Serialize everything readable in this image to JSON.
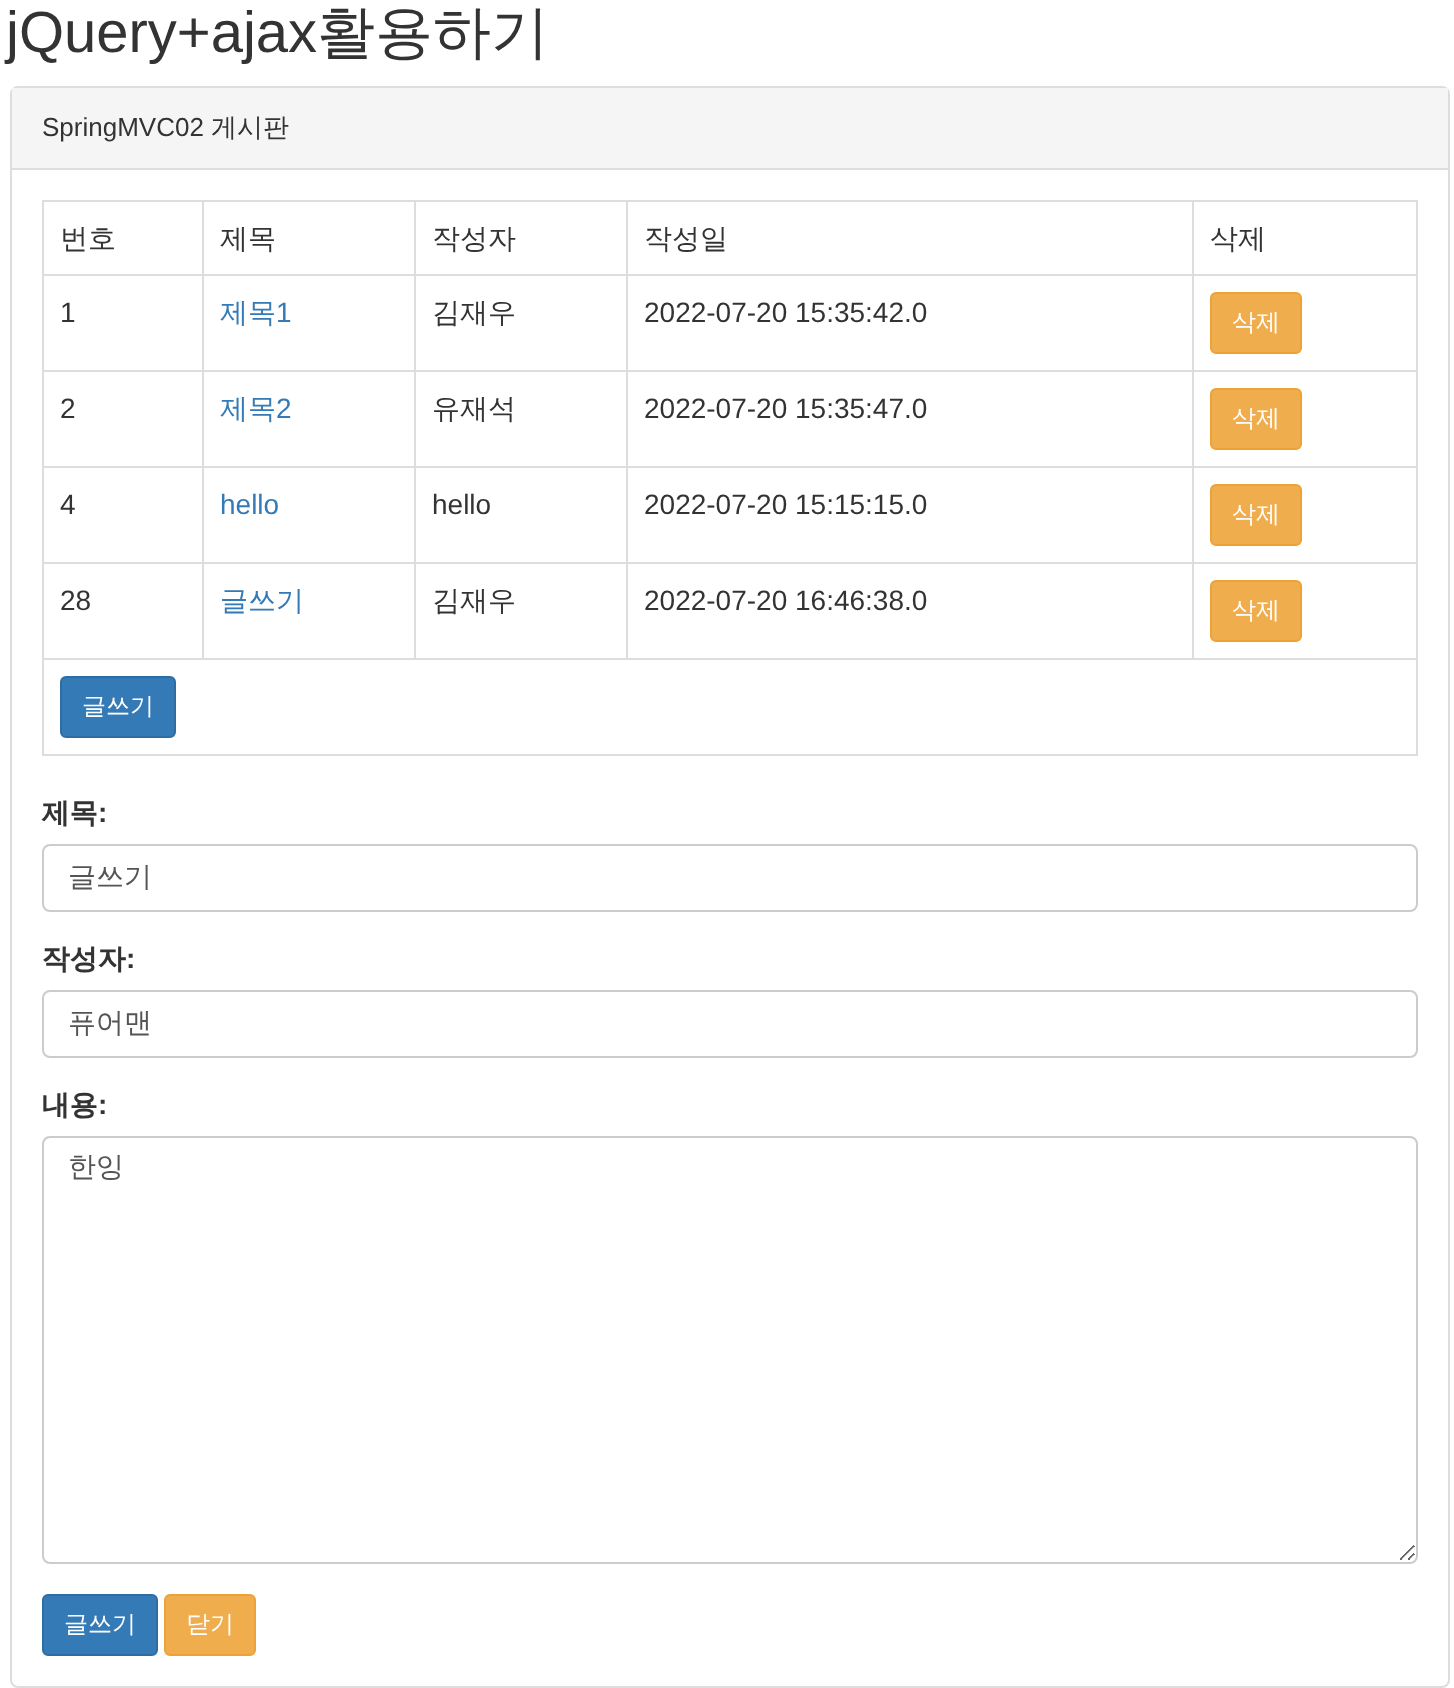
{
  "page_title": "jQuery+ajax활용하기",
  "panel": {
    "heading": "SpringMVC02 게시판",
    "table": {
      "columns": [
        "번호",
        "제목",
        "작성자",
        "작성일",
        "삭제"
      ],
      "rows": [
        {
          "number": "1",
          "title": "제목1",
          "writer": "김재우",
          "date": "2022-07-20 15:35:42.0",
          "delete_button": "삭제"
        },
        {
          "number": "2",
          "title": "제목2",
          "writer": "유재석",
          "date": "2022-07-20 15:35:47.0",
          "delete_button": "삭제"
        },
        {
          "number": "4",
          "title": "hello",
          "writer": "hello",
          "date": "2022-07-20 15:15:15.0",
          "delete_button": "삭제"
        },
        {
          "number": "28",
          "title": "글쓰기",
          "writer": "김재우",
          "date": "2022-07-20 16:46:38.0",
          "delete_button": "삭제"
        }
      ],
      "write_button": "글쓰기"
    },
    "form": {
      "fields": [
        {
          "kind": "input",
          "label": "제목:",
          "value": "글쓰기"
        },
        {
          "kind": "input",
          "label": "작성자:",
          "value": "퓨어맨"
        },
        {
          "kind": "textarea",
          "label": "내용:",
          "value": "한잉"
        }
      ],
      "buttons": [
        {
          "kind": "primary",
          "label": "글쓰기"
        },
        {
          "kind": "warning",
          "label": "닫기"
        }
      ]
    }
  }
}
